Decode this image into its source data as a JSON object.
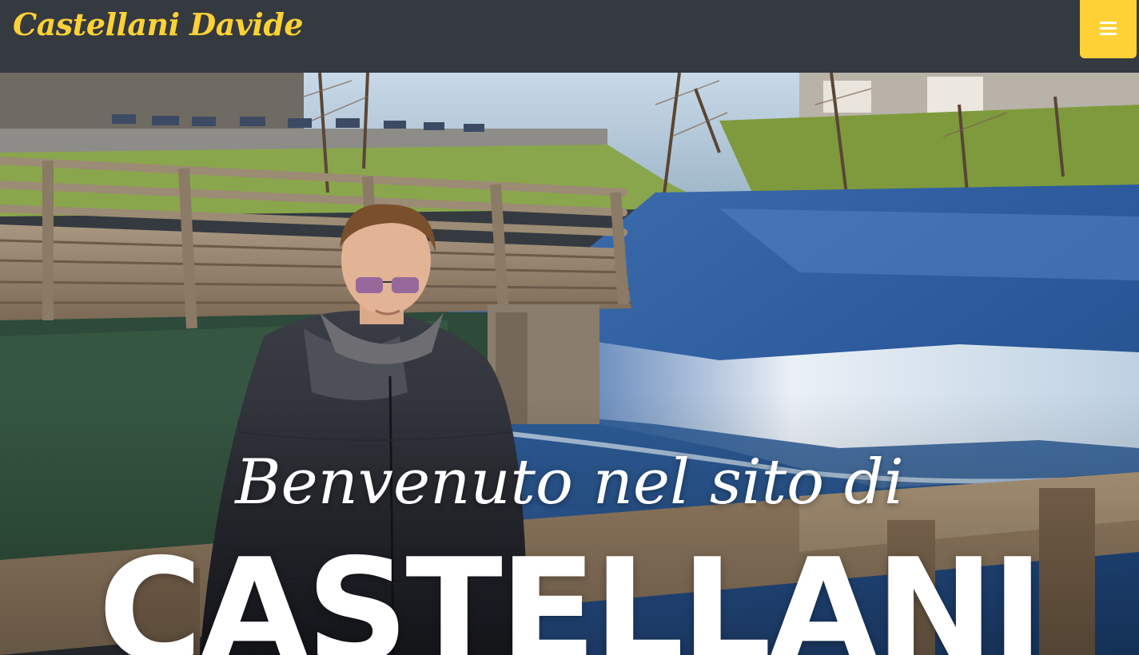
{
  "navbar": {
    "brand": "Castellani Davide",
    "menu_icon": "hamburger-icon"
  },
  "hero": {
    "subheading": "Benvenuto nel sito di",
    "heading": "CASTELLANI",
    "background_image": "person-on-wooden-bridge-by-river-photo"
  },
  "colors": {
    "navbar_bg": "#343a40",
    "accent": "#fed136",
    "hero_text": "#ffffff"
  }
}
